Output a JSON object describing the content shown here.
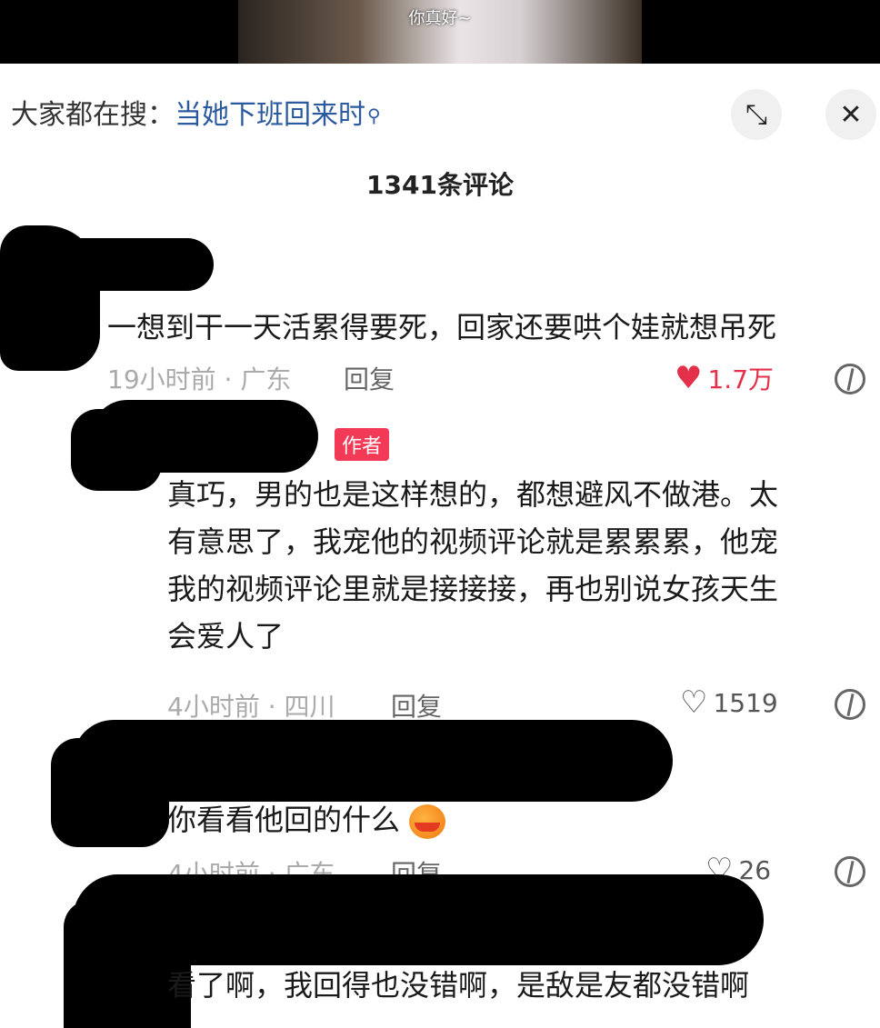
{
  "video": {
    "caption": "你真好~"
  },
  "search": {
    "prefix": "大家都在搜：",
    "term": "当她下班回来时"
  },
  "comments_header": {
    "title": "1341条评论"
  },
  "comments": [
    {
      "text": "一想到干一天活累得要死，回家还要哄个娃就想吊死",
      "time_location": "19小时前 · 广东",
      "reply_label": "回复",
      "likes": "1.7万",
      "liked": true
    },
    {
      "badge": "作者",
      "lines": [
        "真巧，男的也是这样想的，都想避风不做港。太",
        "有意思了，我宠他的视频评论就是累累累，他宠",
        "我的视频评论里就是接接接，再也别说女孩天生",
        "会爱人了"
      ],
      "time_location": "4小时前 · 四川",
      "reply_label": "回复",
      "likes": "1519"
    },
    {
      "text": "你看看他回的什么",
      "time_location": "4小时前 · 广东",
      "reply_label": "回复",
      "likes": "26"
    },
    {
      "text": "看了啊，我回得也没错啊，是敌是友都没错啊"
    }
  ],
  "icons": {
    "heart": "heart-icon",
    "dislike": "broken-heart-icon",
    "expand": "expand-icon",
    "close": "close-icon",
    "search": "search-icon"
  },
  "colors": {
    "liked": "#e3314a",
    "search_term": "#2b5b9e",
    "badge": "#f23a56"
  }
}
